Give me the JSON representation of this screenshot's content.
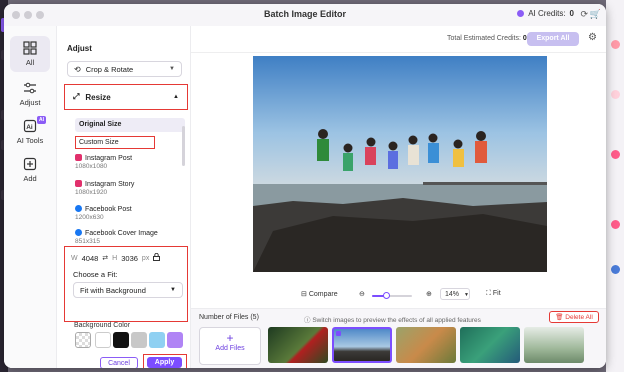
{
  "window": {
    "title": "Batch Image Editor",
    "credits_label": "AI Credits:",
    "credits_value": "0"
  },
  "nav": {
    "items": [
      {
        "label": "All",
        "icon": "grid-icon",
        "active": true
      },
      {
        "label": "Adjust",
        "icon": "sliders-icon"
      },
      {
        "label": "AI Tools",
        "icon": "ai-tools-icon",
        "badge": "AI"
      },
      {
        "label": "Add",
        "icon": "plus-square-icon"
      }
    ]
  },
  "panel": {
    "title": "Adjust",
    "crop_label": "Crop & Rotate",
    "resize_label": "Resize",
    "options": [
      {
        "label": "Original Size",
        "sub": ""
      },
      {
        "label": "Custom Size",
        "sub": ""
      },
      {
        "label": "Instagram Post",
        "sub": "1080x1080"
      },
      {
        "label": "Instagram Story",
        "sub": "1080x1920"
      },
      {
        "label": "Facebook Post",
        "sub": "1200x630"
      },
      {
        "label": "Facebook Cover Image",
        "sub": "851x315"
      }
    ],
    "width_prefix": "W",
    "width_value": "4048",
    "height_prefix": "H",
    "height_value": "3036",
    "unit": "px",
    "fit_label": "Choose a Fit:",
    "fit_value": "Fit with Background",
    "bg_color_label": "Background Color",
    "swatch_colors": [
      "#ffffff",
      "#111111",
      "#c8c8c8",
      "#8fd0f2",
      "#b084f5"
    ],
    "cancel_label": "Cancel",
    "apply_label": "Apply"
  },
  "main": {
    "est_label": "Total Estimated Credits:",
    "est_value": "0",
    "export_label": "Export All",
    "compare_label": "Compare",
    "zoom_value": "14%",
    "zoom_level": 0.35,
    "fit_label": "Fit",
    "files_label": "Number of Files (5)",
    "hint_text": "Switch images to preview the effects of all applied features",
    "delete_label": "Delete All",
    "add_files_label": "Add Files"
  },
  "colors": {
    "accent": "#7c4dff",
    "highlight": "#e53935"
  }
}
